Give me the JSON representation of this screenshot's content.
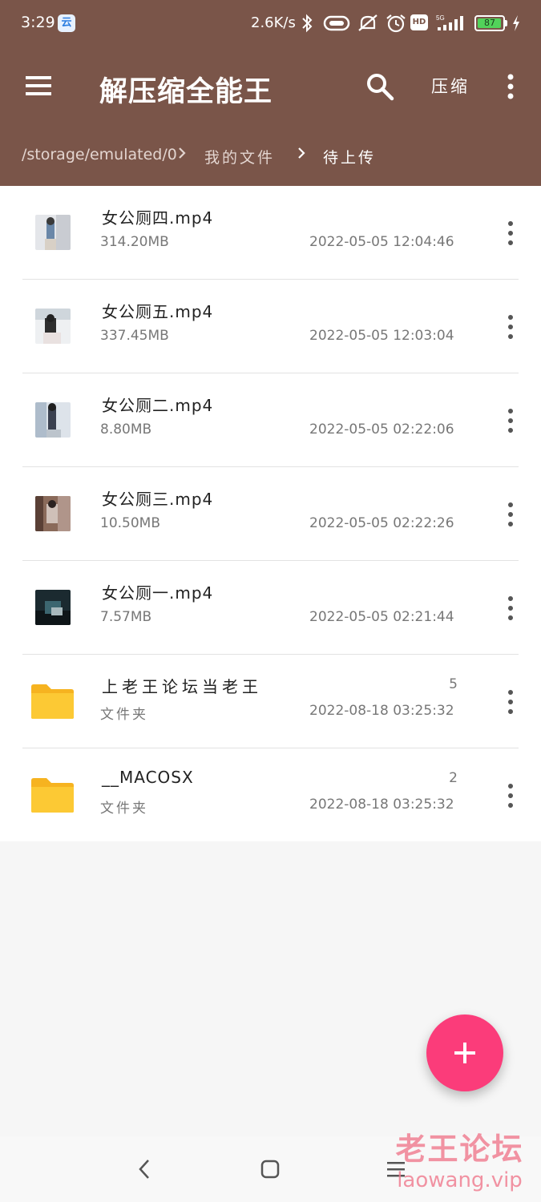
{
  "status_bar": {
    "time": "3:29",
    "cloud_icon_label": "云",
    "net_speed": "2.6K/s",
    "hd_label": "HD",
    "signal_label": "5G",
    "battery": "87",
    "icons": [
      "bluetooth-icon",
      "vibrate-icon",
      "mute-icon",
      "alarm-icon",
      "hd-icon",
      "signal-5g-icon",
      "battery-icon",
      "charging-icon"
    ]
  },
  "toolbar": {
    "title": "解压缩全能王",
    "compress_label": "压缩",
    "icons": [
      "menu-icon",
      "search-icon",
      "more-vert-icon"
    ]
  },
  "breadcrumb": {
    "items": [
      "/storage/emulated/0",
      "我的文件",
      "待上传"
    ]
  },
  "files": [
    {
      "name": "女公厕四.mp4",
      "size": "314.20MB",
      "date": "2022-05-05 12:04:46",
      "type": "video"
    },
    {
      "name": "女公厕五.mp4",
      "size": "337.45MB",
      "date": "2022-05-05 12:03:04",
      "type": "video"
    },
    {
      "name": "女公厕二.mp4",
      "size": "8.80MB",
      "date": "2022-05-05 02:22:06",
      "type": "video"
    },
    {
      "name": "女公厕三.mp4",
      "size": "10.50MB",
      "date": "2022-05-05 02:22:26",
      "type": "video"
    },
    {
      "name": "女公厕一.mp4",
      "size": "7.57MB",
      "date": "2022-05-05 02:21:44",
      "type": "video"
    },
    {
      "name": "上老王论坛当老王",
      "size": "文件夹",
      "count": "5",
      "date": "2022-08-18 03:25:32",
      "type": "folder"
    },
    {
      "name": "__MACOSX",
      "size": "文件夹",
      "count": "2",
      "date": "2022-08-18 03:25:32",
      "type": "folder"
    }
  ],
  "fab": {
    "icon": "plus-icon"
  },
  "navbar": {
    "icons": [
      "back-icon",
      "home-icon",
      "recents-icon"
    ]
  },
  "watermark": {
    "title": "老王论坛",
    "url": "laowang.vip"
  },
  "colors": {
    "header": "#7a5549",
    "fab": "#fb3c7a",
    "folder": "#fbc52d"
  }
}
